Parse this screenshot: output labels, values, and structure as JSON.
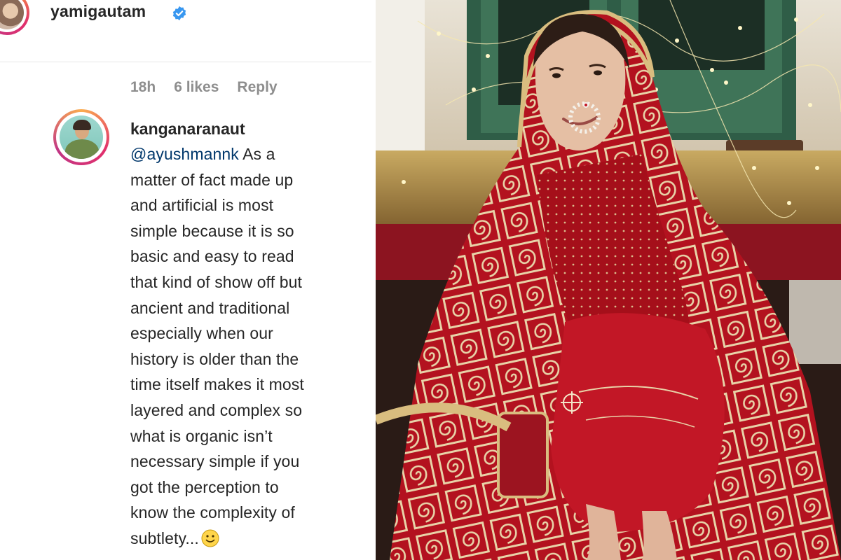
{
  "post": {
    "author_username": "yamigautam",
    "verified": true
  },
  "comment": {
    "timestamp": "18h",
    "likes": "6 likes",
    "reply_label": "Reply",
    "username": "kanganaranaut",
    "mention": "@ayushmannk",
    "lines": [
      "As a",
      "matter of fact made up",
      "and artificial is most",
      "simple because it is so",
      "basic and easy to read",
      "that kind of show off but",
      "ancient and traditional",
      "especially when our",
      "history is older than the",
      "time itself makes it most",
      "layered and complex so",
      "what is organic isn’t",
      "necessary simple if you",
      "got the perception to",
      "know the complexity of",
      "subtlety..."
    ],
    "emoji": "slightly-smiling-face-icon"
  },
  "colors": {
    "text": "#262626",
    "muted": "#8e8e8e",
    "mention": "#00376b",
    "verified": "#3897f0",
    "dupatta_red": "#b3121f",
    "embroidery_gold": "#e8d3a8"
  }
}
